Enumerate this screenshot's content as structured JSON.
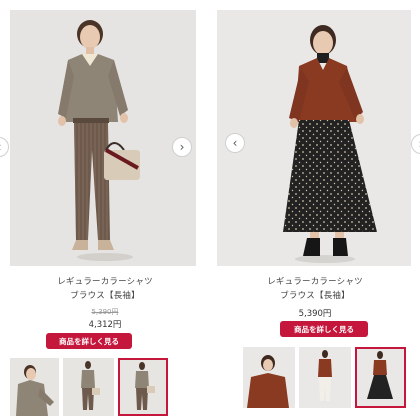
{
  "products": [
    {
      "name_line1": "レギュラーカラーシャツ",
      "name_line2": "ブラウス【長袖】",
      "original_price": "5,390円",
      "price": "4,312円",
      "detail_button_label": "商品を詳しく見る",
      "thumbnails": [
        "look-front",
        "look-full",
        "look-side"
      ],
      "active_thumbnail": 2,
      "colors": {
        "shirt": "#8f8576",
        "pants": "#6e5a4c",
        "bag": "#d8cbb8"
      }
    },
    {
      "name_line1": "レギュラーカラーシャツ",
      "name_line2": "ブラウス【長袖】",
      "price": "5,390円",
      "detail_button_label": "商品を詳しく見る",
      "thumbnails": [
        "look-front",
        "look-white-pants",
        "look-skirt"
      ],
      "active_thumbnail": 2,
      "colors": {
        "shirt": "#8b3a22",
        "skirt": "#222222"
      }
    }
  ],
  "nav_icons": {
    "prev": "‹",
    "next": "›"
  },
  "accent_color": "#c5163c"
}
